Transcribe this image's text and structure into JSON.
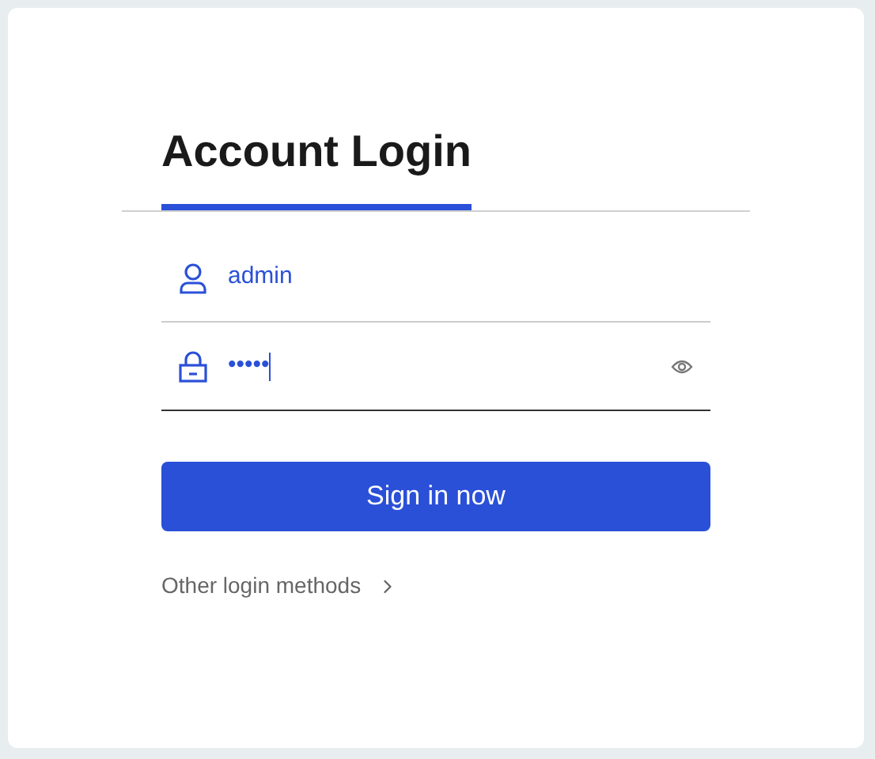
{
  "tabs": [
    {
      "label": "Account Login",
      "selected": true
    }
  ],
  "fields": [
    {
      "kind": "user",
      "value": "admin",
      "focused": false
    },
    {
      "kind": "password",
      "value": "•••••",
      "focused": true
    }
  ],
  "submit": "Sign in now",
  "other_methods": "Other login methods"
}
